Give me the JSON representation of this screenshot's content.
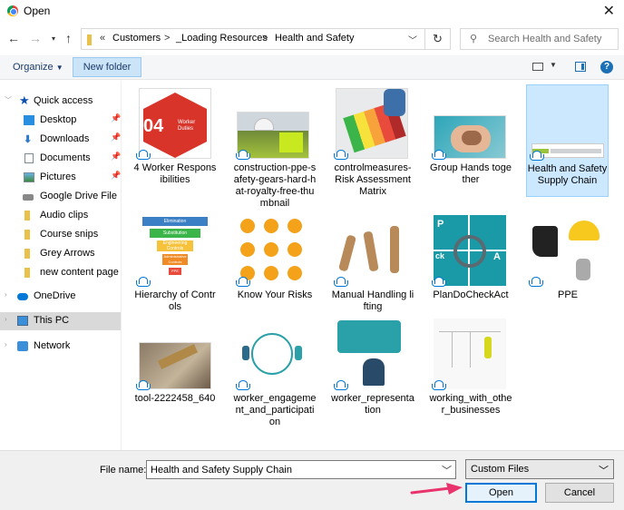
{
  "window": {
    "title": "Open"
  },
  "address": {
    "overflow": "«",
    "crumbs": [
      "Customers",
      "_Loading Resources",
      "Health and Safety"
    ],
    "separator": ">"
  },
  "search": {
    "placeholder": "Search Health and Safety"
  },
  "toolbar": {
    "organize": "Organize",
    "new_folder": "New folder"
  },
  "sidebar": {
    "quick_access": "Quick access",
    "items": [
      {
        "label": "Desktop",
        "icon": "desktop-icon",
        "pinned": true
      },
      {
        "label": "Downloads",
        "icon": "download-icon",
        "pinned": true
      },
      {
        "label": "Documents",
        "icon": "documents-icon",
        "pinned": true
      },
      {
        "label": "Pictures",
        "icon": "pictures-icon",
        "pinned": true
      },
      {
        "label": "Google Drive File",
        "icon": "google-drive-icon",
        "pinned": false
      },
      {
        "label": "Audio clips",
        "icon": "folder-icon",
        "pinned": false
      },
      {
        "label": "Course snips",
        "icon": "folder-icon",
        "pinned": false
      },
      {
        "label": "Grey Arrows",
        "icon": "folder-icon",
        "pinned": false
      },
      {
        "label": "new content page s",
        "icon": "folder-icon",
        "pinned": false
      }
    ],
    "onedrive": "OneDrive",
    "thispc": "This PC",
    "network": "Network"
  },
  "files": [
    {
      "name": "4 Worker Responsibilities",
      "thumb": "worker-duties",
      "selected": false
    },
    {
      "name": "construction-ppe-safety-gears-hard-hat-royalty-free-thumbnail",
      "thumb": "hard-hat",
      "selected": false
    },
    {
      "name": "controlmeasures-Risk Assessment Matrix",
      "thumb": "risk-matrix",
      "selected": false
    },
    {
      "name": "Group Hands together",
      "thumb": "hands",
      "selected": false
    },
    {
      "name": "Health and Safety Supply Chain",
      "thumb": "supply-chain",
      "selected": true
    },
    {
      "name": "Hierarchy of Controls",
      "thumb": "hierarchy",
      "selected": false
    },
    {
      "name": "Know Your Risks",
      "thumb": "risks",
      "selected": false
    },
    {
      "name": "Manual Handling lifting",
      "thumb": "lifting",
      "selected": false
    },
    {
      "name": "PlanDoCheckAct",
      "thumb": "pdca",
      "selected": false
    },
    {
      "name": "PPE",
      "thumb": "ppe",
      "selected": false
    },
    {
      "name": "tool-2222458_640",
      "thumb": "tool",
      "selected": false
    },
    {
      "name": "worker_engagement_and_participation",
      "thumb": "engagement",
      "selected": false
    },
    {
      "name": "worker_representation",
      "thumb": "representation",
      "selected": false
    },
    {
      "name": "working_with_other_businesses",
      "thumb": "businesses",
      "selected": false
    }
  ],
  "thumb_text": {
    "duties_number": "04",
    "duties_caption": "Worker Duties",
    "hierarchy_levels": [
      "Elimination",
      "Substitution",
      "Engineering Controls",
      "Administrative Controls",
      "PPE"
    ],
    "pdca_letters": [
      "P",
      "ck",
      "A"
    ]
  },
  "footer": {
    "filename_label": "File name:",
    "filename_value": "Health and Safety Supply Chain",
    "filter": "Custom Files",
    "open": "Open",
    "cancel": "Cancel"
  },
  "colors": {
    "accent": "#0078d7",
    "selection": "#cce8ff",
    "annotation_arrow": "#e8336d"
  }
}
